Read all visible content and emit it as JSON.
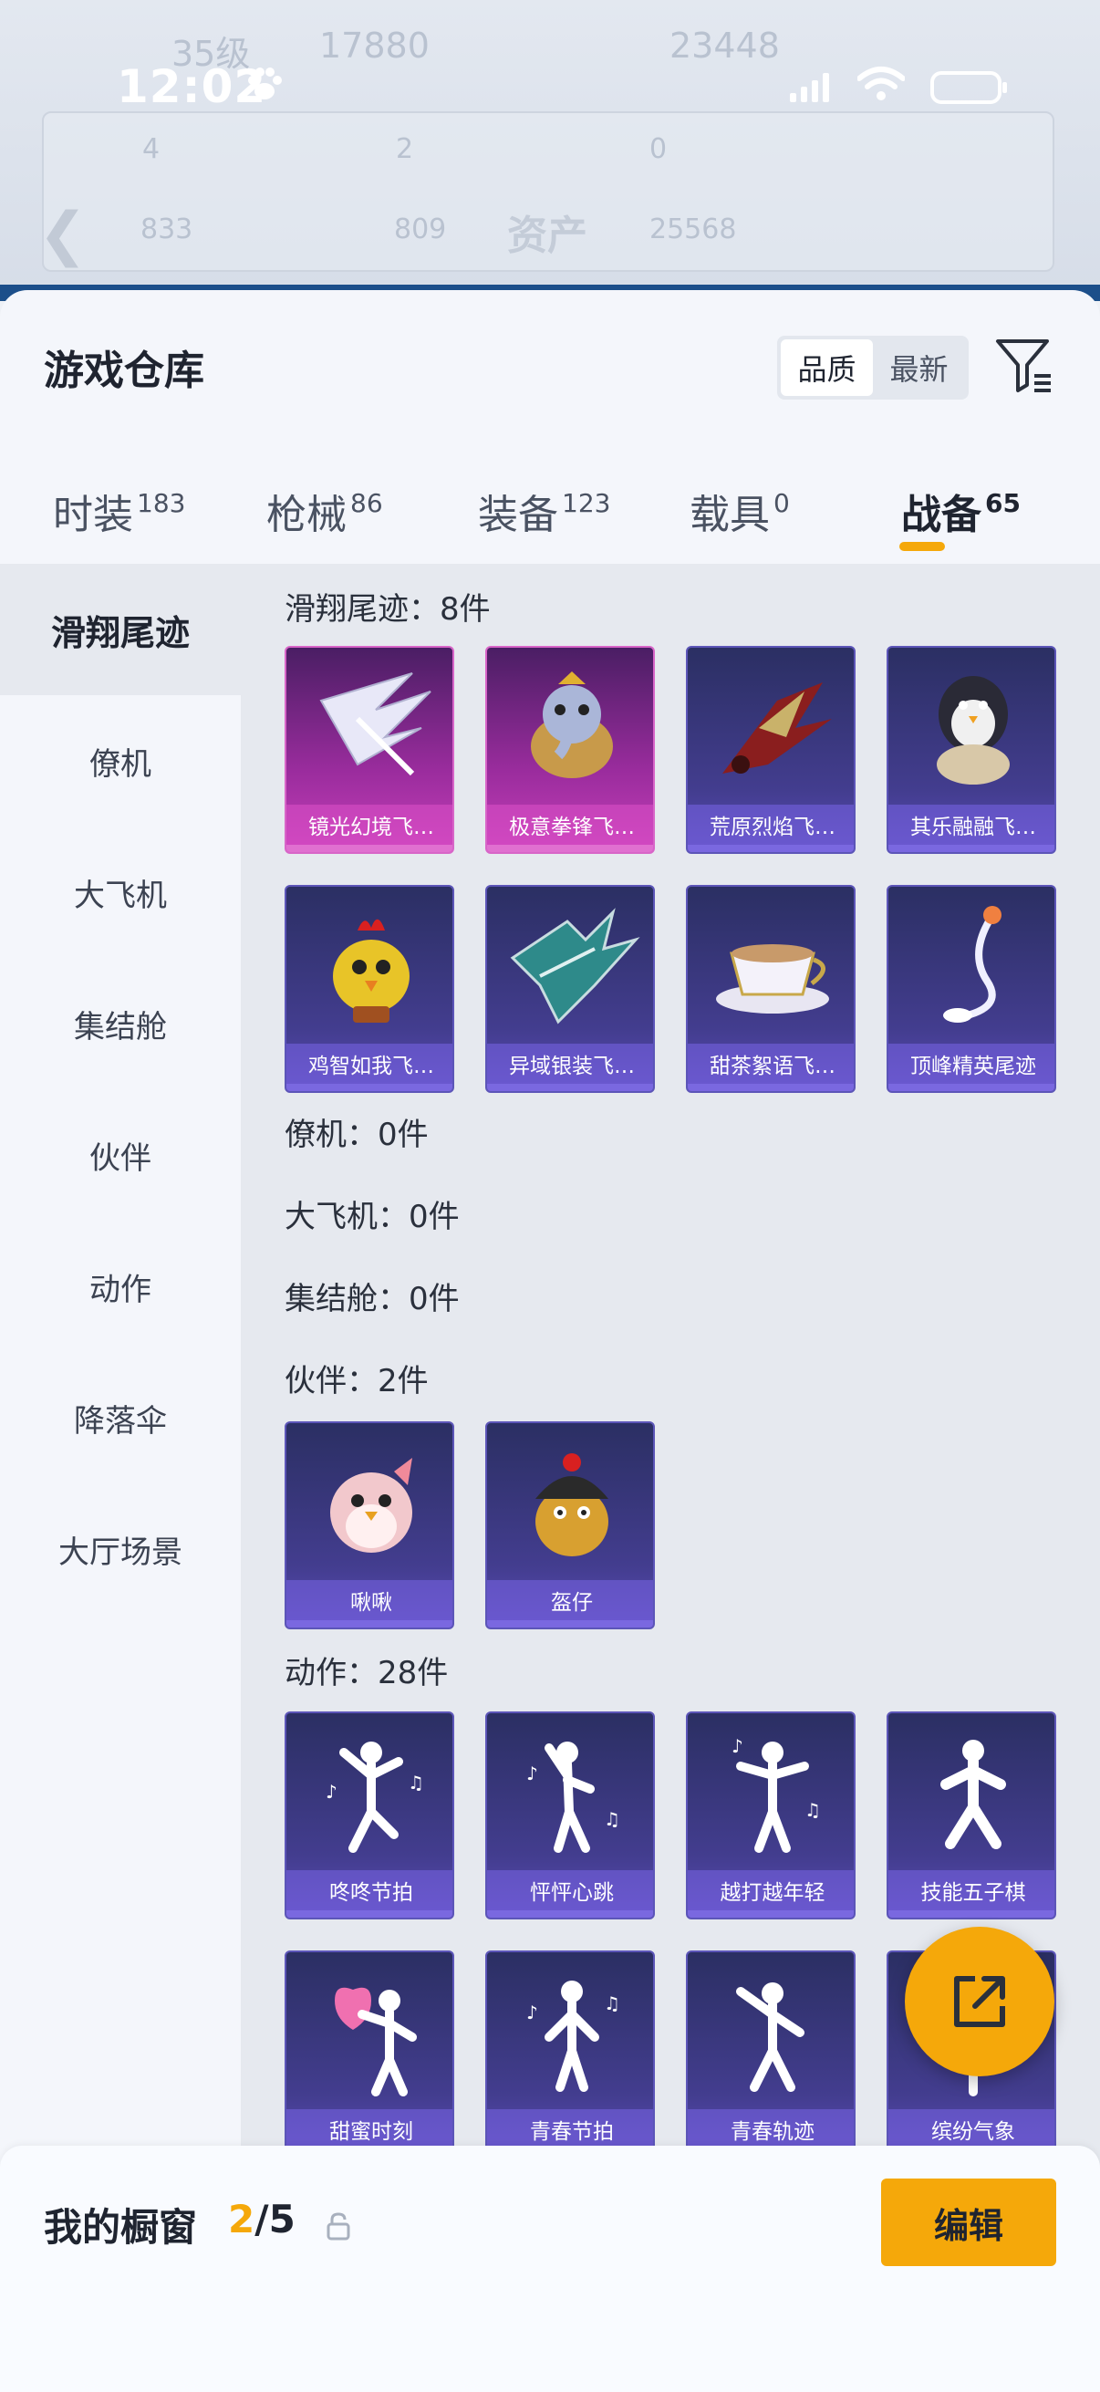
{
  "status_bar": {
    "time": "12:02"
  },
  "background_page": {
    "stats": [
      "35级",
      "17880",
      "23448",
      "4",
      "2",
      "0",
      "833",
      "809",
      "25568"
    ],
    "assets_label": "资产"
  },
  "sheet": {
    "title": "游戏仓库",
    "sort_options": [
      "品质",
      "最新"
    ],
    "sort_selected": "品质"
  },
  "tabs": [
    {
      "label": "时装",
      "count": "183"
    },
    {
      "label": "枪械",
      "count": "86"
    },
    {
      "label": "装备",
      "count": "123"
    },
    {
      "label": "载具",
      "count": "0"
    },
    {
      "label": "战备",
      "count": "65"
    }
  ],
  "sidebar": {
    "items": [
      "滑翔尾迹",
      "僚机",
      "大飞机",
      "集结舱",
      "伙伴",
      "动作",
      "降落伞",
      "大厅场景"
    ],
    "active": "滑翔尾迹"
  },
  "sections": {
    "glide": {
      "label": "滑翔尾迹：8件",
      "items": [
        "镜光幻境飞…",
        "极意拳锋飞…",
        "荒原烈焰飞…",
        "其乐融融飞…",
        "鸡智如我飞…",
        "异域银装飞…",
        "甜茶絮语飞…",
        "顶峰精英尾迹"
      ]
    },
    "wingman": {
      "label": "僚机：0件"
    },
    "plane": {
      "label": "大飞机：0件"
    },
    "capsule": {
      "label": "集结舱：0件"
    },
    "partner": {
      "label": "伙伴：2件",
      "items": [
        "啾啾",
        "盔仔"
      ]
    },
    "emote": {
      "label": "动作：28件",
      "items": [
        "咚咚节拍",
        "怦怦心跳",
        "越打越年轻",
        "技能五子棋",
        "甜蜜时刻",
        "青春节拍",
        "青春轨迹",
        "缤纷气象"
      ]
    }
  },
  "showcase": {
    "label": "我的橱窗",
    "current": "2",
    "total": "/5",
    "edit_label": "编辑"
  },
  "colors": {
    "accent": "#f5a80a",
    "card_purple": "#433d8f",
    "card_pink": "#9a2c9d"
  }
}
